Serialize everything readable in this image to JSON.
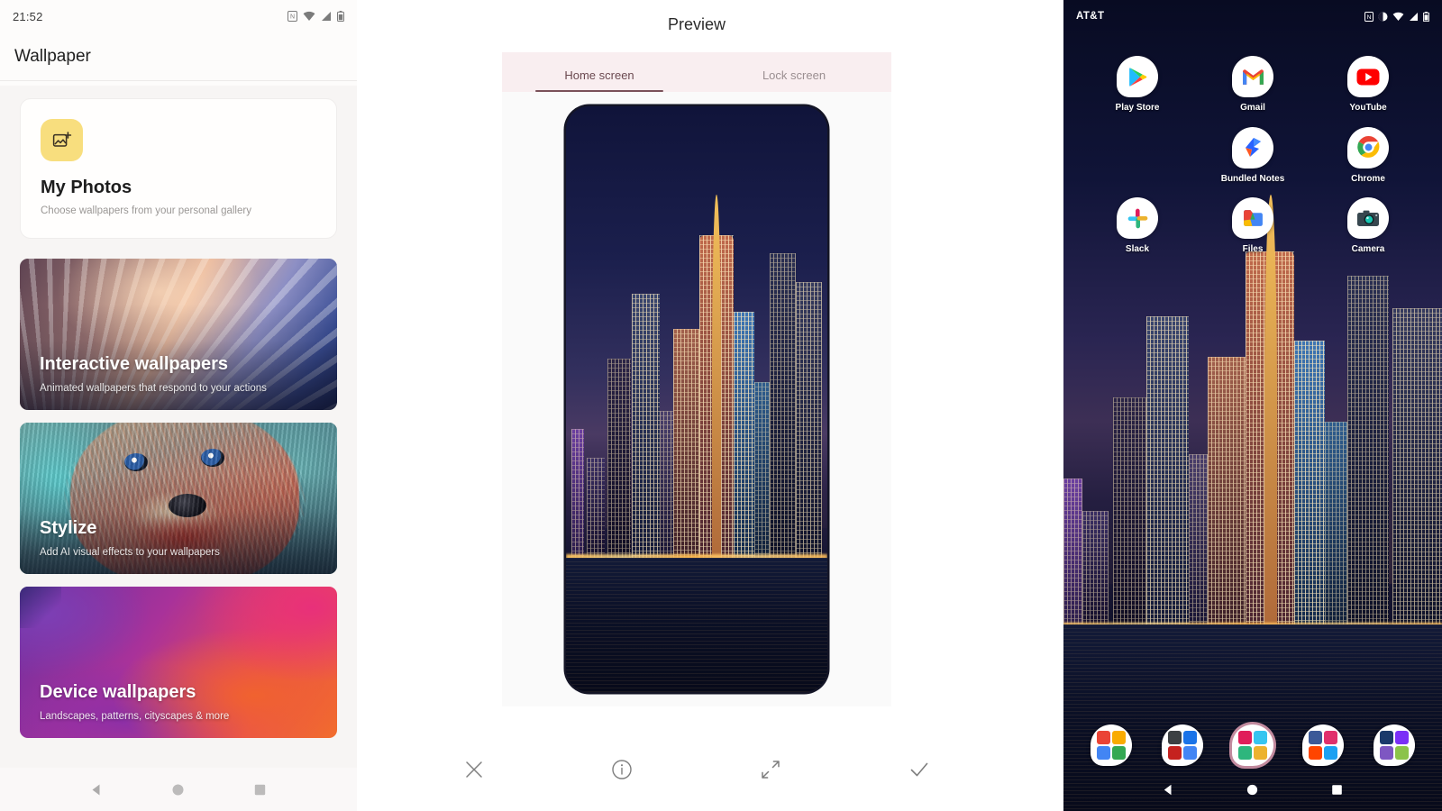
{
  "left_panel": {
    "status_bar": {
      "clock": "21:52",
      "icons": [
        "sim-card-icon",
        "wifi-icon",
        "signal-icon",
        "battery-icon"
      ]
    },
    "app_bar": {
      "title": "Wallpaper"
    },
    "my_photos": {
      "icon": "add-photo-icon",
      "title": "My Photos",
      "subtitle": "Choose wallpapers from your personal gallery",
      "icon_bg": "#f8de7e"
    },
    "categories": [
      {
        "id": "interactive",
        "title": "Interactive wallpapers",
        "subtitle": "Animated wallpapers that respond to your actions"
      },
      {
        "id": "stylize",
        "title": "Stylize",
        "subtitle": "Add AI visual effects to your wallpapers"
      },
      {
        "id": "device",
        "title": "Device wallpapers",
        "subtitle": "Landscapes, patterns, cityscapes & more"
      }
    ],
    "nav_bar": {
      "back": "back-icon",
      "home": "home-icon",
      "recents": "recents-icon"
    }
  },
  "middle_panel": {
    "title": "Preview",
    "tabs": [
      {
        "label": "Home screen",
        "active": true
      },
      {
        "label": "Lock screen",
        "active": false
      }
    ],
    "actions": [
      {
        "name": "close-button",
        "icon": "close-icon"
      },
      {
        "name": "info-button",
        "icon": "info-circle-icon"
      },
      {
        "name": "fullscreen-button",
        "icon": "expand-arrows-icon"
      },
      {
        "name": "apply-button",
        "icon": "check-icon"
      }
    ],
    "preview_image": "night-cityscape-skyline"
  },
  "right_panel": {
    "status_bar": {
      "carrier": "AT&T",
      "icons": [
        "sim-card-icon",
        "notification-icon",
        "wifi-icon",
        "signal-icon",
        "battery-icon"
      ]
    },
    "apps": [
      [
        {
          "label": "Play Store",
          "icon": "play-store-icon"
        },
        {
          "label": "Gmail",
          "icon": "gmail-icon"
        },
        {
          "label": "YouTube",
          "icon": "youtube-icon"
        }
      ],
      [
        {
          "label": "",
          "icon": ""
        },
        {
          "label": "Bundled Notes",
          "icon": "bundled-notes-icon"
        },
        {
          "label": "Chrome",
          "icon": "chrome-icon"
        }
      ],
      [
        {
          "label": "Slack",
          "icon": "slack-icon"
        },
        {
          "label": "Files",
          "icon": "files-icon"
        },
        {
          "label": "Camera",
          "icon": "camera-icon"
        }
      ]
    ],
    "dock": [
      {
        "name": "dock-folder-google",
        "type": "folder",
        "colors": [
          "#ea4335",
          "#f9ab00",
          "#4285f4",
          "#34a853"
        ]
      },
      {
        "name": "dock-folder-media",
        "type": "folder",
        "colors": [
          "#3c4043",
          "#1a73e8",
          "#c5221f",
          "#4285f4"
        ]
      },
      {
        "name": "dock-app-slack",
        "type": "app",
        "highlight": true,
        "colors": [
          "#e01e5a",
          "#36c5f0",
          "#2eb67d",
          "#ecb22e"
        ]
      },
      {
        "name": "dock-folder-social",
        "type": "folder",
        "colors": [
          "#3b5998",
          "#e1306c",
          "#ff4500",
          "#1da1f2"
        ]
      },
      {
        "name": "dock-folder-work",
        "type": "folder",
        "colors": [
          "#1b3a6b",
          "#7b2ff7",
          "#7e57c2",
          "#8bc34a"
        ]
      }
    ],
    "nav_bar": {
      "back": "back-icon",
      "home": "home-icon",
      "recents": "recents-icon"
    }
  }
}
